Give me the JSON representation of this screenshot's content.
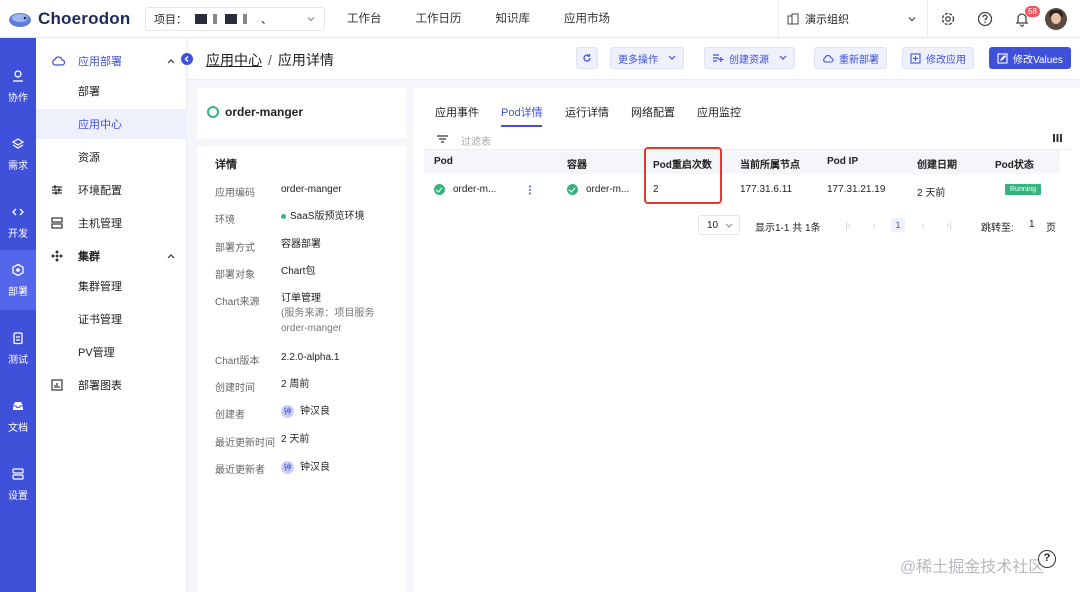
{
  "app": {
    "name": "Choerodon"
  },
  "header": {
    "project_label": "项目：",
    "project_suffix": "、",
    "nav": [
      "工作台",
      "工作日历",
      "知识库",
      "应用市场"
    ],
    "org": "演示组织",
    "notif_count": "58"
  },
  "rail": [
    {
      "label": "协作",
      "icon": "collab-icon"
    },
    {
      "label": "需求",
      "icon": "layers-icon"
    },
    {
      "label": "开发",
      "icon": "code-icon"
    },
    {
      "label": "部署",
      "icon": "deploy-icon"
    },
    {
      "label": "测试",
      "icon": "clipboard-icon"
    },
    {
      "label": "文档",
      "icon": "inbox-icon"
    },
    {
      "label": "设置",
      "icon": "server-icon"
    }
  ],
  "menu": {
    "group1": "应用部署",
    "items1": [
      "部署",
      "应用中心",
      "资源"
    ],
    "env": "环境配置",
    "host": "主机管理",
    "cluster": "集群",
    "items2": [
      "集群管理",
      "证书管理",
      "PV管理"
    ],
    "chart": "部署图表"
  },
  "breadcrumb": {
    "parent": "应用中心",
    "sep": "/",
    "current": "应用详情"
  },
  "actions": {
    "more": "更多操作",
    "create": "创建资源",
    "redeploy": "重新部署",
    "modify_app": "修改应用",
    "modify_values": "修改Values"
  },
  "detail": {
    "app_name": "order-manger",
    "title": "详情",
    "fields": [
      {
        "k": "应用编码",
        "v": "order-manger"
      },
      {
        "k": "环境",
        "v": "SaaS版预览环境"
      },
      {
        "k": "部署方式",
        "v": "容器部署"
      },
      {
        "k": "部署对象",
        "v": "Chart包"
      },
      {
        "k": "Chart来源",
        "v": "订单管理",
        "v2": "(服务来源：项目服务",
        "v3": "order-manger"
      },
      {
        "k": "Chart版本",
        "v": "2.2.0-alpha.1"
      },
      {
        "k": "创建时间",
        "v": "2 周前"
      },
      {
        "k": "创建者",
        "v": "钟汉良",
        "avatar": "钟"
      },
      {
        "k": "最近更新时间",
        "v": "2 天前"
      },
      {
        "k": "最近更新者",
        "v": "钟汉良",
        "avatar": "钟"
      }
    ]
  },
  "tabs": [
    "应用事件",
    "Pod详情",
    "运行详情",
    "网络配置",
    "应用监控"
  ],
  "filter_placeholder": "过滤表",
  "table": {
    "headers": [
      "Pod",
      "容器",
      "Pod重启次数",
      "当前所属节点",
      "Pod IP",
      "创建日期",
      "Pod状态"
    ],
    "rows": [
      {
        "pod": "order-m...",
        "container": "order-m...",
        "restarts": "2",
        "node": "177.31.6.11",
        "ip": "177.31.21.19",
        "created": "2 天前",
        "status": "Running"
      }
    ]
  },
  "pagination": {
    "size": "10",
    "summary": "显示1-1 共 1条",
    "page": "1",
    "jump_label": "跳转至:",
    "jump_value": "1",
    "unit": "页"
  },
  "watermark": "@稀土掘金技术社区"
}
